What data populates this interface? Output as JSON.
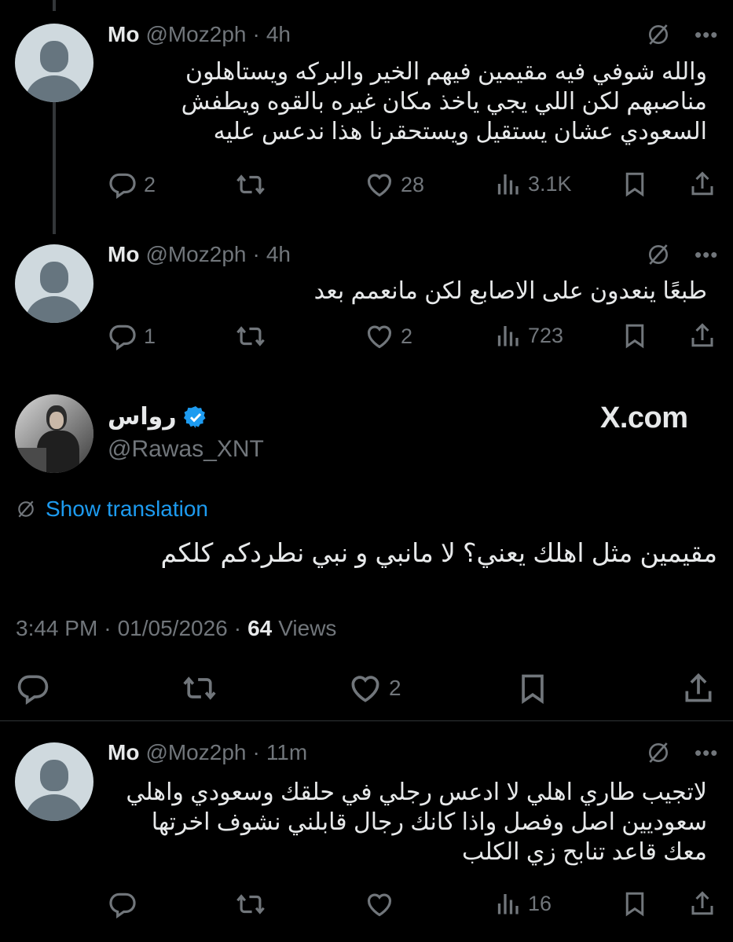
{
  "replies_above": [
    {
      "name": "Mo",
      "handle": "@Moz2ph",
      "sep": "·",
      "time": "4h",
      "text_lines": [
        "والله شوفي فيه مقيمين فيهم الخير والبركه ويستاهلون",
        "مناصبهم لكن اللي يجي ياخذ مكان غيره بالقوه ويطفش",
        "السعودي عشان يستقيل ويستحقرنا هذا ندعس عليه"
      ],
      "replies": "2",
      "reposts": "",
      "likes": "28",
      "views": "3.1K"
    },
    {
      "name": "Mo",
      "handle": "@Moz2ph",
      "sep": "·",
      "time": "4h",
      "text_lines": [
        "طبعًا ينعدون على الاصابع لكن مانعمم بعد"
      ],
      "replies": "1",
      "reposts": "",
      "likes": "2",
      "views": "723"
    }
  ],
  "main_tweet": {
    "name": "رواس",
    "handle": "@Rawas_XNT",
    "watermark": "X.com",
    "show_translation": "Show translation",
    "text": "مقيمين مثل اهلك يعني؟ لا مانبي و نبي نطردكم كلكم",
    "time": "3:44 PM",
    "date": "01/05/2026",
    "sep": "·",
    "views_count": "64",
    "views_label": "Views",
    "likes": "2"
  },
  "reply_below": {
    "name": "Mo",
    "handle": "@Moz2ph",
    "sep": "·",
    "time": "11m",
    "text_lines": [
      "لاتجيب طاري اهلي لا ادعس رجلي في حلقك وسعودي واهلي",
      "سعوديين اصل وفصل واذا كانك رجال قابلني نشوف اخرتها",
      "معك قاعد تنابح زي الكلب"
    ],
    "views": "16"
  },
  "icons": {
    "reply": "reply-icon",
    "repost": "repost-icon",
    "like": "heart-icon",
    "views": "views-chart-icon",
    "bookmark": "bookmark-icon",
    "share": "share-icon",
    "grok": "grok-slash-icon",
    "more": "more-dots-icon",
    "verified": "verified-badge-icon",
    "translate": "translate-icon"
  },
  "colors": {
    "background": "#000000",
    "text": "#e7e9ea",
    "muted": "#71767b",
    "link": "#1d9bf0",
    "verified": "#1d9bf0",
    "divider": "#2f3336"
  }
}
